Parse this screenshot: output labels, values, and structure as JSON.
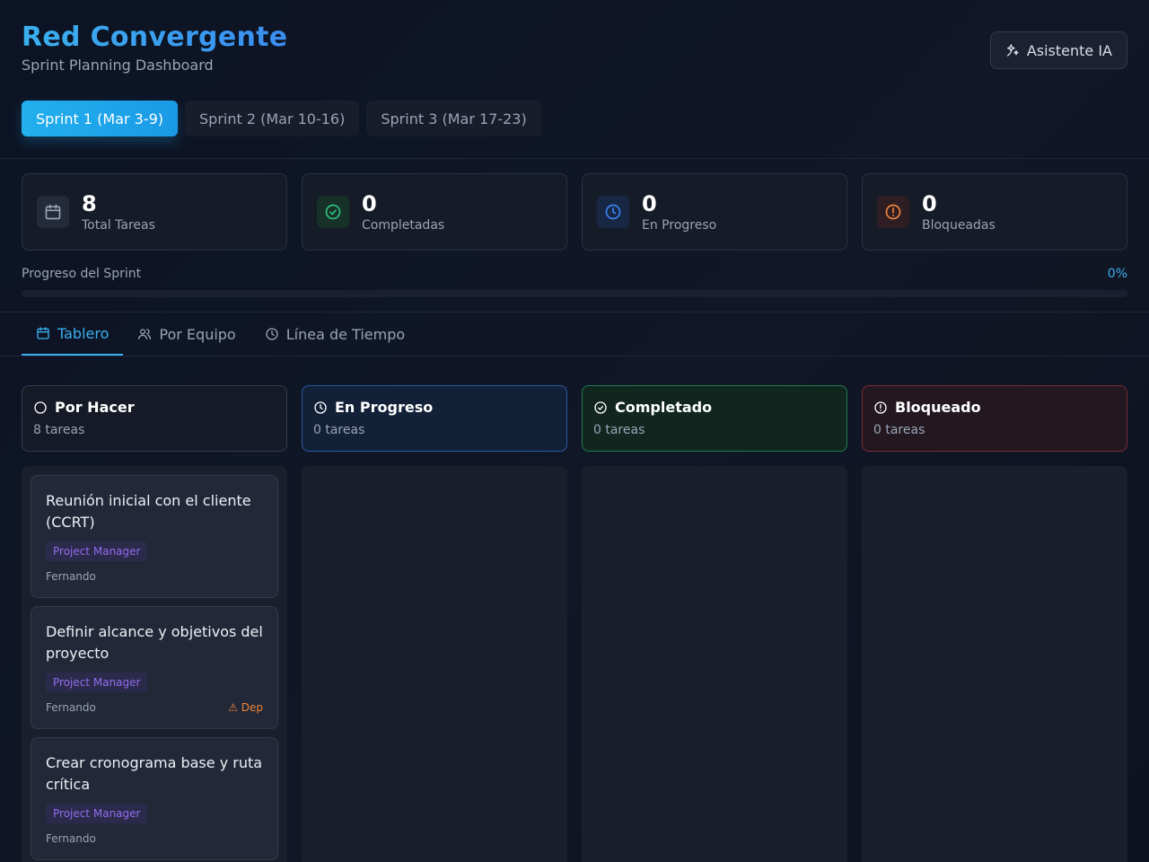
{
  "app": {
    "title": "Red Convergente",
    "subtitle": "Sprint Planning Dashboard"
  },
  "ai_button": {
    "label": "Asistente IA",
    "icon": "sparkles-icon"
  },
  "sprint_tabs": [
    {
      "label": "Sprint 1 (Mar 3-9)",
      "active": true
    },
    {
      "label": "Sprint 2 (Mar 10-16)",
      "active": false
    },
    {
      "label": "Sprint 3 (Mar 17-23)",
      "active": false
    }
  ],
  "stats": [
    {
      "value": "8",
      "label": "Total Tareas",
      "icon": "calendar-icon",
      "color": "#9aa3b5"
    },
    {
      "value": "0",
      "label": "Completadas",
      "icon": "check-circle-icon",
      "color": "#2ec27e"
    },
    {
      "value": "0",
      "label": "En Progreso",
      "icon": "clock-icon",
      "color": "#3b82f6"
    },
    {
      "value": "0",
      "label": "Bloqueadas",
      "icon": "alert-circle-icon",
      "color": "#f0853a"
    }
  ],
  "progress": {
    "label": "Progreso del Sprint",
    "percent_text": "0%",
    "fraction": 0
  },
  "view_tabs": [
    {
      "label": "Tablero",
      "icon": "calendar-icon",
      "active": true
    },
    {
      "label": "Por Equipo",
      "icon": "users-icon",
      "active": false
    },
    {
      "label": "Línea de Tiempo",
      "icon": "clock-icon",
      "active": false
    }
  ],
  "columns": [
    {
      "title": "Por Hacer",
      "count": "8 tareas",
      "icon": "circle-icon"
    },
    {
      "title": "En Progreso",
      "count": "0 tareas",
      "icon": "clock-icon"
    },
    {
      "title": "Completado",
      "count": "0 tareas",
      "icon": "check-circle-icon"
    },
    {
      "title": "Bloqueado",
      "count": "0 tareas",
      "icon": "alert-circle-icon"
    }
  ],
  "tasks": [
    {
      "title": "Reunión inicial con el cliente (CCRT)",
      "role": "Project Manager",
      "assignee": "Fernando",
      "dependency": ""
    },
    {
      "title": "Definir alcance y objetivos del proyecto",
      "role": "Project Manager",
      "assignee": "Fernando",
      "dependency": "⚠ Dep"
    },
    {
      "title": "Crear cronograma base y ruta crítica",
      "role": "Project Manager",
      "assignee": "Fernando",
      "dependency": ""
    }
  ],
  "colors": {
    "accent": "#3ab0ee",
    "background": "#0d1220",
    "role_badge": "#8f6df0",
    "dependency": "#f0853a"
  }
}
